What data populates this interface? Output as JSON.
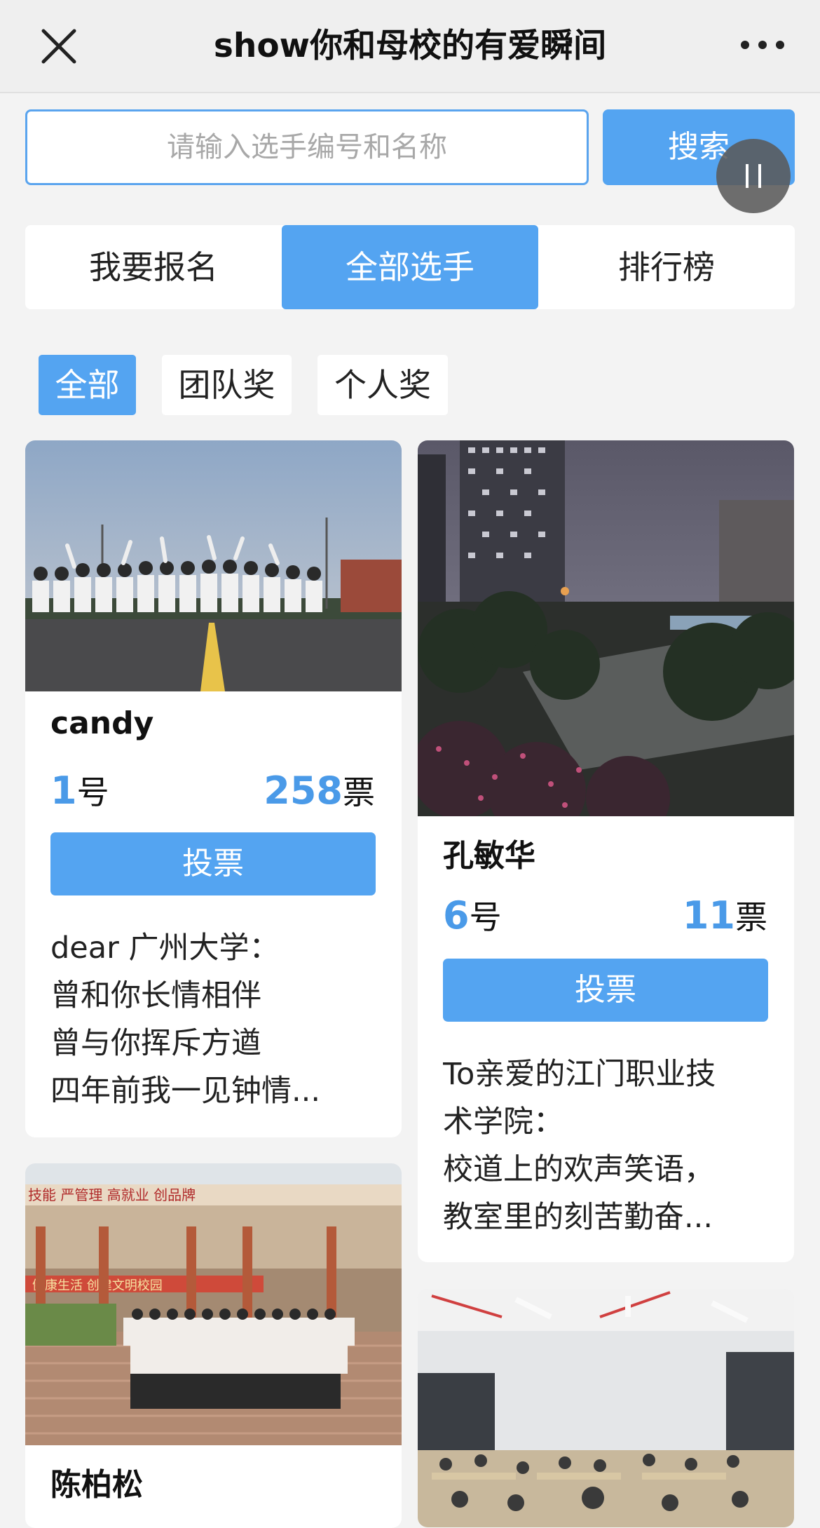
{
  "nav": {
    "title": "show你和母校的有爱瞬间",
    "close_icon": "close-icon",
    "more_icon": "more-dots-icon"
  },
  "search": {
    "placeholder": "请输入选手编号和名称",
    "value": "",
    "button_label": "搜索"
  },
  "tabs": [
    {
      "label": "我要报名",
      "active": false
    },
    {
      "label": "全部选手",
      "active": true
    },
    {
      "label": "排行榜",
      "active": false
    }
  ],
  "filters": [
    {
      "label": "全部",
      "active": true
    },
    {
      "label": "团队奖",
      "active": false
    },
    {
      "label": "个人奖",
      "active": false
    }
  ],
  "cards": [
    {
      "name": "candy",
      "number": "1",
      "number_suffix": "号",
      "votes": "258",
      "votes_suffix": "票",
      "vote_label": "投票",
      "desc": [
        "dear 广州大学：",
        "曾和你长情相伴",
        "曾与你挥斥方遒",
        "四年前我一见钟情..."
      ]
    },
    {
      "name": "孔敏华",
      "number": "6",
      "number_suffix": "号",
      "votes": "11",
      "votes_suffix": "票",
      "vote_label": "投票",
      "desc": [
        "To亲爱的江门职业技",
        "术学院：",
        "校道上的欢声笑语，",
        "教室里的刻苦勤奋..."
      ]
    },
    {
      "name": "陈柏松"
    },
    {
      "name": ""
    }
  ],
  "photo_banner_text": {
    "sign_top": "技能 严管理 高就业 创品牌",
    "sign_mid": "健康生活 创建文明校园"
  },
  "colors": {
    "accent": "#54a4f1",
    "accent_text": "#4a9ae8",
    "background": "#f3f3f3"
  }
}
